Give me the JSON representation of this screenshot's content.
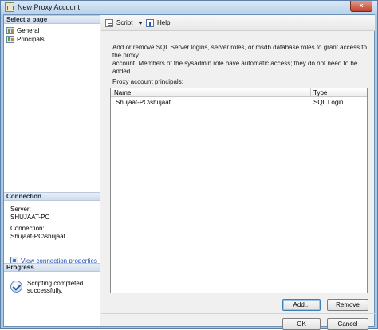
{
  "window": {
    "title": "New Proxy Account",
    "close_glyph": "×"
  },
  "left_pane": {
    "select_page_header": "Select a page",
    "pages": [
      {
        "label": "General",
        "icon": "page-icon"
      },
      {
        "label": "Principals",
        "icon": "page-icon"
      }
    ],
    "connection_header": "Connection",
    "server_label": "Server:",
    "server_value": "SHUJAAT-PC",
    "connection_label": "Connection:",
    "connection_value": "Shujaat-PC\\shujaat",
    "view_connection_link": "View connection properties",
    "progress_header": "Progress",
    "progress_line1": "Scripting completed",
    "progress_line2": "successfully."
  },
  "toolbar": {
    "script_label": "Script",
    "help_label": "Help"
  },
  "main": {
    "description_line1": "Add or remove SQL Server logins, server roles, or msdb database roles to grant access to the proxy",
    "description_line2": "account. Members of the sysadmin role have automatic access; they do not need to be added.",
    "list_label": "Proxy account principals:",
    "columns": {
      "name": "Name",
      "type": "Type"
    },
    "rows": [
      {
        "name": "Shujaat-PC\\shujaat",
        "type": "SQL Login"
      }
    ],
    "add_button": "Add...",
    "remove_button": "Remove"
  },
  "footer": {
    "ok_button": "OK",
    "cancel_button": "Cancel"
  }
}
